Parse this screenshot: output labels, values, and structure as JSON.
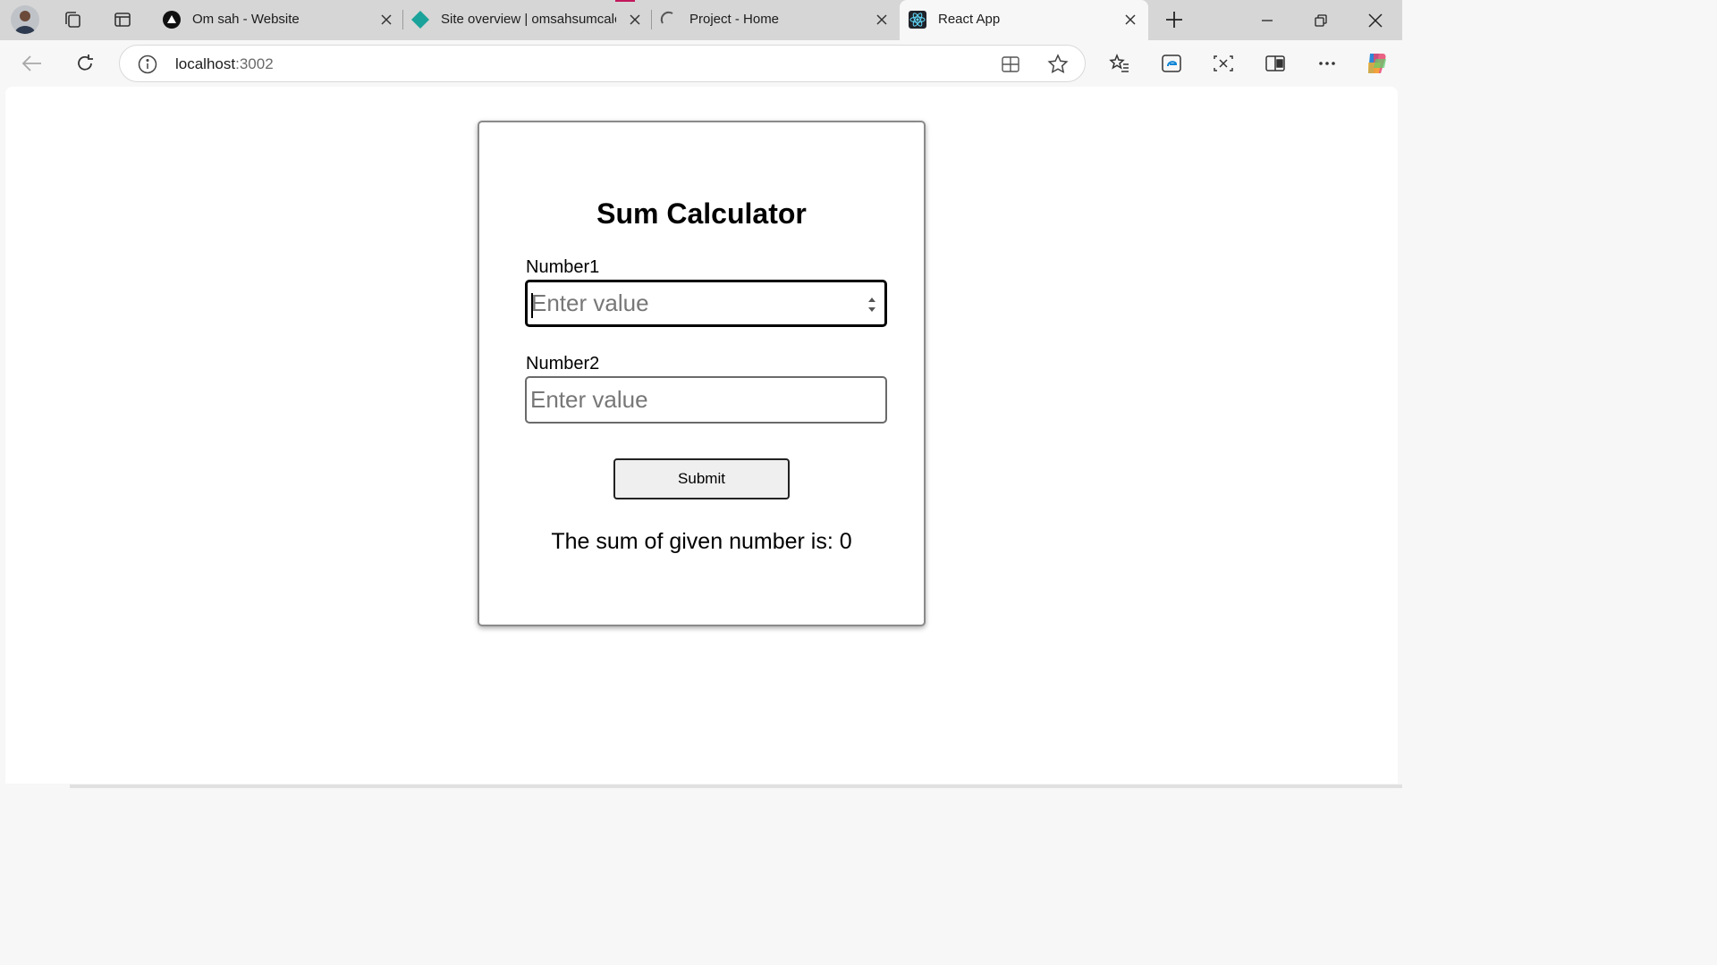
{
  "browser": {
    "tabs": [
      {
        "title": "Om sah - Website",
        "active": false
      },
      {
        "title": "Site overview | omsahsumcalc",
        "active": false
      },
      {
        "title": "Project - Home",
        "active": false,
        "loading": true
      },
      {
        "title": "React App",
        "active": true
      }
    ],
    "address": {
      "host": "localhost",
      "port": ":3002"
    },
    "accent_loading": "#c2185b"
  },
  "app": {
    "title": "Sum Calculator",
    "number1": {
      "label": "Number1",
      "placeholder": "Enter value",
      "value": ""
    },
    "number2": {
      "label": "Number2",
      "placeholder": "Enter value",
      "value": ""
    },
    "submit_label": "Submit",
    "result_text": "The sum of given number is: 0"
  }
}
